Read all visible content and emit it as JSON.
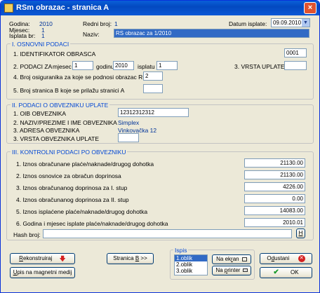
{
  "window": {
    "title": "RSm obrazac - stranica A",
    "close_glyph": "×"
  },
  "header": {
    "godina_label": "Godina:",
    "godina_value": "2010",
    "mjesec_label": "Mjesec:",
    "mjesec_value": "1",
    "isplata_label": "Isplata br:",
    "isplata_value": "1",
    "redni_label": "Redni broj:",
    "redni_value": "1",
    "naziv_label": "Naziv:",
    "naziv_value": "RS obrazac za 1/2010",
    "datum_label": "Datum isplate:",
    "datum_value": "09.09.2010"
  },
  "section1": {
    "title": "I. OSNOVNI PODACI",
    "f1_label": "1. IDENTIFIKATOR OBRASCA",
    "f1_value": "0001",
    "f2_label": "2. PODACI ZA",
    "mjesec_label": "mjesec",
    "mjesec_value": "1",
    "godinu_label": "godinu",
    "godinu_value": "2010",
    "isplatu_label": "isplatu",
    "isplatu_value": "1",
    "f3_label": "3. VRSTA UPLATE",
    "f3_value": "",
    "f4_label": "4. Broj osiguranika za koje se podnosi obrazac R-S",
    "f4_value": "2",
    "f5_label": "5. Broj stranica B koje se prilažu stranici A",
    "f5_value": ""
  },
  "section2": {
    "title": "II. PODACI O OBVEZNIKU UPLATE",
    "f1_label": "1. OIB OBVEZNIKA",
    "f1_value": "12312312312",
    "f2_label": "2. NAZIV/PREZIME I IME OBVEZNIKA",
    "f2_value": "Simplex",
    "f3_label": "3. ADRESA OBVEZNIKA",
    "f3_value": "Vinkovačka 12",
    "f4_label": "3. VRSTA OBVEZNIKA UPLATE",
    "f4_value": ""
  },
  "section3": {
    "title": "III. KONTROLNI PODACI PO OBVEZNIKU",
    "rows": [
      {
        "label": "1.   Iznos obračunane plaće/naknade/drugog dohotka",
        "value": "21130.00"
      },
      {
        "label": "2.   Iznos osnovice za obračun doprinosa",
        "value": "21130.00"
      },
      {
        "label": "3.   Iznos obračunanog doprinosa za I. stup",
        "value": "4226.00"
      },
      {
        "label": "4.   Iznos obračunanog doprinosa za II. stup",
        "value": "0.00"
      },
      {
        "label": "5.   Iznos isplaćene plaće/naknade/drugog dohotka",
        "value": "14083.00"
      },
      {
        "label": "6.   Godina i mjesec isplate plaće/naknade/drugog dohotka",
        "value": "2010.01"
      }
    ],
    "hash_label": "Hash broj:",
    "hash_value": "",
    "hash_button": "H"
  },
  "bottom": {
    "rekonstruiraj_pre": "",
    "rekonstruiraj_u": "R",
    "rekonstruiraj_post": "ekonstruiraj",
    "upis_pre": "",
    "upis_u": "U",
    "upis_post": "pis na magnetni medij",
    "stranica_pre": "Stranica ",
    "stranica_u": "B",
    "stranica_post": " >>",
    "ispis_title": "Ispis",
    "ispis_options": [
      "1.oblik",
      "2.oblik",
      "3.oblik"
    ],
    "naekran_pre": "Na ek",
    "naekran_u": "r",
    "naekran_post": "an",
    "naprinter_pre": "Na ",
    "naprinter_u": "p",
    "naprinter_post": "rinter",
    "odustani_pre": "O",
    "odustani_u": "d",
    "odustani_post": "ustani",
    "ok_label": "OK"
  },
  "colors": {
    "title_blue": "#0046d5",
    "value_blue": "#003399",
    "ok_green": "#1a9a2a",
    "cancel_red": "#d42020"
  }
}
